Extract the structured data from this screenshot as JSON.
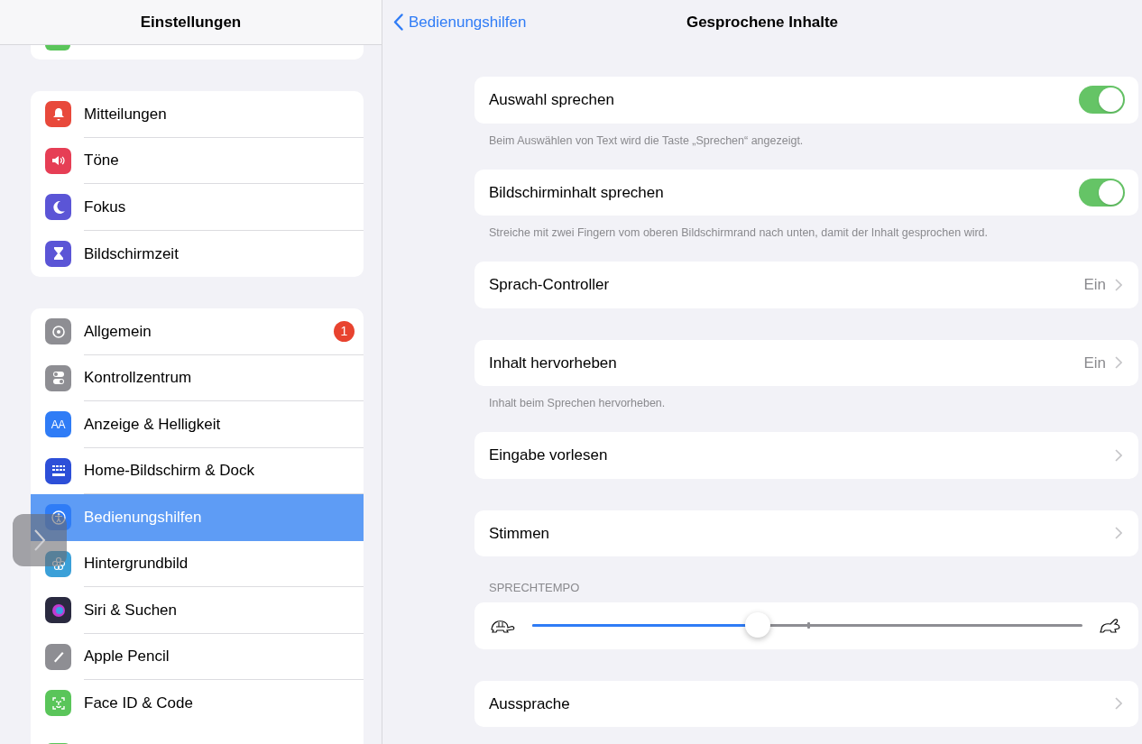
{
  "sidebar": {
    "title": "Einstellungen",
    "groups": [
      {
        "items": [
          {
            "label": "Mitteilungen",
            "color": "#e8493b",
            "selected": false
          },
          {
            "label": "Töne",
            "color": "#e63e55",
            "selected": false
          },
          {
            "label": "Fokus",
            "color": "#5b55d6",
            "selected": false
          },
          {
            "label": "Bildschirmzeit",
            "color": "#5b55d6",
            "selected": false
          }
        ]
      },
      {
        "items": [
          {
            "label": "Allgemein",
            "color": "#8e8e93",
            "selected": false,
            "badge": "1"
          },
          {
            "label": "Kontrollzentrum",
            "color": "#8e8e93",
            "selected": false
          },
          {
            "label": "Anzeige & Helligkeit",
            "color": "#2f7cf6",
            "selected": false,
            "glyph": "AA"
          },
          {
            "label": "Home-Bildschirm & Dock",
            "color": "#2d4fd8",
            "selected": false
          },
          {
            "label": "Bedienungshilfen",
            "color": "#2f7cf6",
            "selected": true
          },
          {
            "label": "Hintergrundbild",
            "color": "#3ba0d8",
            "selected": false
          },
          {
            "label": "Siri & Suchen",
            "color": "#2a2a40",
            "selected": false
          },
          {
            "label": "Apple Pencil",
            "color": "#8e8e93",
            "selected": false
          },
          {
            "label": "Face ID & Code",
            "color": "#5ac55a",
            "selected": false
          }
        ]
      }
    ]
  },
  "nav": {
    "back": "Bedienungshilfen",
    "title": "Gesprochene Inhalte"
  },
  "sections": [
    {
      "rows": [
        {
          "kind": "toggle",
          "label": "Auswahl sprechen",
          "on": true
        }
      ],
      "footer": "Beim Auswählen von Text wird die Taste „Sprechen“ angezeigt."
    },
    {
      "rows": [
        {
          "kind": "toggle",
          "label": "Bildschirminhalt sprechen",
          "on": true
        }
      ],
      "footer": "Streiche mit zwei Fingern vom oberen Bildschirmrand nach unten, damit der Inhalt gesprochen wird."
    },
    {
      "rows": [
        {
          "kind": "disclosure",
          "label": "Sprach-Controller",
          "value": "Ein"
        }
      ]
    },
    {
      "rows": [
        {
          "kind": "disclosure",
          "label": "Inhalt hervorheben",
          "value": "Ein"
        }
      ],
      "footer": "Inhalt beim Sprechen hervorheben."
    },
    {
      "rows": [
        {
          "kind": "disclosure",
          "label": "Eingabe vorlesen"
        }
      ]
    },
    {
      "rows": [
        {
          "kind": "disclosure",
          "label": "Stimmen"
        }
      ]
    },
    {
      "header": "SPRECHTEMPO",
      "rows": [
        {
          "kind": "slider",
          "level": 0.41
        }
      ]
    },
    {
      "rows": [
        {
          "kind": "disclosure",
          "label": "Aussprache"
        }
      ]
    }
  ]
}
